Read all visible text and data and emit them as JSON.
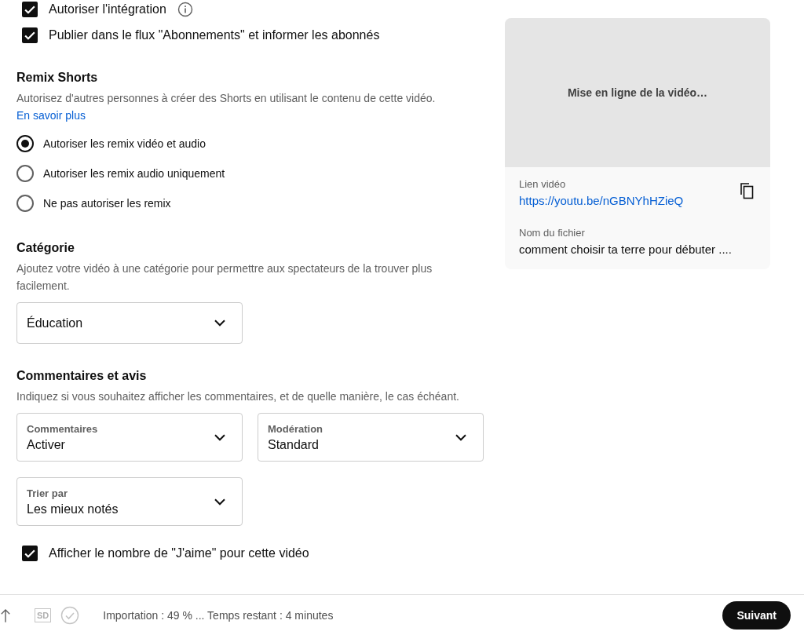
{
  "checkboxes_top": [
    {
      "label": "Autoriser l'intégration",
      "checked": true,
      "info": true
    },
    {
      "label": "Publier dans le flux \"Abonnements\" et informer les abonnés",
      "checked": true,
      "info": false
    }
  ],
  "remix": {
    "title": "Remix Shorts",
    "description": "Autorisez d'autres personnes à créer des Shorts en utilisant le contenu de cette vidéo.",
    "link": "En savoir plus",
    "options": [
      {
        "label": "Autoriser les remix vidéo et audio",
        "selected": true
      },
      {
        "label": "Autoriser les remix audio uniquement",
        "selected": false
      },
      {
        "label": "Ne pas autoriser les remix",
        "selected": false
      }
    ]
  },
  "category": {
    "title": "Catégorie",
    "description": "Ajoutez votre vidéo à une catégorie pour permettre aux spectateurs de la trouver plus facilement.",
    "value": "Éducation"
  },
  "comments": {
    "title": "Commentaires et avis",
    "description": "Indiquez si vous souhaitez afficher les commentaires, et de quelle manière, le cas échéant.",
    "dropdowns": [
      {
        "label": "Commentaires",
        "value": "Activer"
      },
      {
        "label": "Modération",
        "value": "Standard"
      },
      {
        "label": "Trier par",
        "value": "Les mieux notés"
      }
    ],
    "likes": {
      "label": "Afficher le nombre de \"J'aime\" pour cette vidéo",
      "checked": true
    }
  },
  "preview": {
    "status": "Mise en ligne de la vidéo…",
    "link_label": "Lien vidéo",
    "link": "https://youtu.be/nGBNYhHZieQ",
    "filename_label": "Nom du fichier",
    "filename": "comment choisir ta terre pour débuter ...."
  },
  "footer": {
    "badge": "SD",
    "status": "Importation : 49 % ... Temps restant : 4 minutes",
    "button": "Suivant"
  }
}
